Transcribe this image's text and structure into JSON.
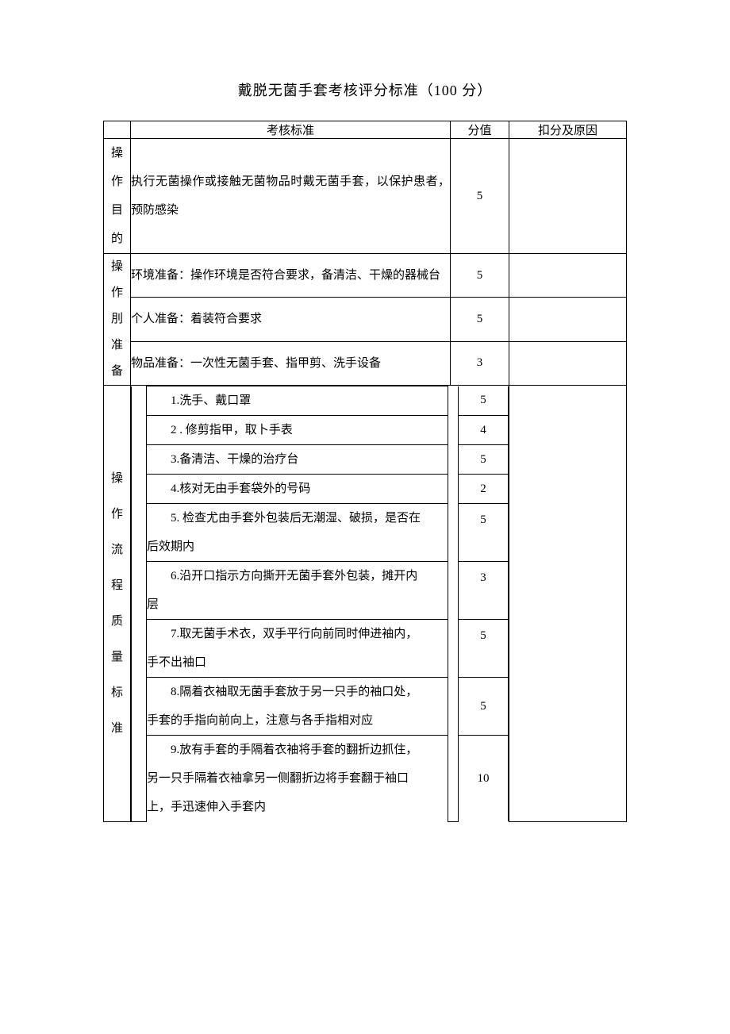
{
  "title": "戴脱无菌手套考核评分标准（100 分）",
  "headers": {
    "col1": "",
    "criteria": "考核标准",
    "score": "分值",
    "reason": "扣分及原因"
  },
  "sections": {
    "purpose": {
      "label": "操\n作\n目\n的",
      "text": "执行无菌操作或接触无菌物品时戴无菌手套，以保护患者，预防感染",
      "score": "5",
      "reason": ""
    },
    "prep": {
      "label": "操\n作\n刖\n准\n备",
      "rows": [
        {
          "text": "环境准备：操作环境是否符合要求，备清洁、干燥的器械台",
          "score": "5",
          "reason": ""
        },
        {
          "text": "个人准备：着装符合要求",
          "score": "5",
          "reason": ""
        },
        {
          "text": "物品准备：一次性无菌手套、指甲剪、洗手设备",
          "score": "3",
          "reason": ""
        }
      ]
    },
    "process": {
      "label": "操\n作\n流\n程\n质\n量\n标\n准",
      "steps": [
        {
          "text": "1.洗手、戴口罩",
          "score": "5"
        },
        {
          "text": "2 . 修剪指甲，取卜手表",
          "score": "4"
        },
        {
          "text": "3.备清洁、干燥的治疗台",
          "score": "5"
        },
        {
          "text": "4.核对无由手套袋外的号码",
          "score": "2"
        },
        {
          "lines": [
            "5. 检查尤由手套外包装后无潮湿、破损，是否在",
            "后效期内"
          ],
          "score": "5"
        },
        {
          "lines": [
            "6.沿开口指示方向撕开无菌手套外包装，摊开内",
            "层"
          ],
          "score": "3"
        },
        {
          "lines": [
            "7.取无菌手术衣，双手平行向前同时伸进袖内，",
            "手不出袖口"
          ],
          "score": "5"
        },
        {
          "lines": [
            "8.隔着衣袖取无菌手套放于另一只手的袖口处，",
            "手套的手指向前向上，注意与各手指相对应"
          ],
          "score": "5"
        },
        {
          "lines": [
            "9.放有手套的手隔着衣袖将手套的翻折边抓住，",
            "另一只手隔着衣袖拿另一侧翻折边将手套翻于袖口",
            "上，手迅速伸入手套内"
          ],
          "score": "10"
        }
      ],
      "reason": ""
    }
  }
}
